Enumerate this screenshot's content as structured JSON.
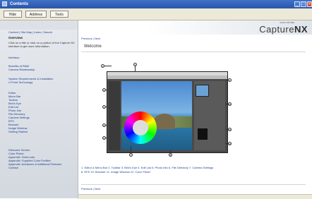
{
  "window": {
    "title": "Contents"
  },
  "tabs": [
    "Hide",
    "Address",
    "Tools"
  ],
  "sidebar": {
    "top_links": "Content | Site Map | Index | Search",
    "heading": "Overview",
    "intro": "Click on a title or click on a portion of the Capture NX interface to get more information.",
    "items": [
      "Interface",
      "Benefits of RAW",
      "Camera Relationship",
      "System Requirements & Installation",
      "U Point Technology",
      "Editor",
      "Menu Bar",
      "Toolbar",
      "Bird's Eye",
      "Edit List",
      "Photo Info",
      "File Directory",
      "Camera Settings",
      "EFS",
      "Browser",
      "Image Window",
      "Getting Started",
      "Welcome Screen",
      "Color Picker",
      "Appendix: Short-cuts",
      "Appendix: Supplied Color Profiles",
      "Appendix: Advances & Additional Features",
      "Contact"
    ]
  },
  "banner": {
    "small": "NIKON CAPTURE",
    "brand_main": "Capture",
    "brand_suffix": "NX"
  },
  "nav": {
    "prev": "Previous",
    "sep": " | ",
    "next": "Next"
  },
  "page_title": "Welcome",
  "links_line1": "1. Editor & Menu Bar  2. Toolbar  3. Bird's Eye  4. Edit List  5. Photo Info  6. File Directory  7. Camera Settings",
  "links_line2": "8. EFS  10. Browser  11. Image Window  12. Color Picker",
  "callouts": [
    "1",
    "2",
    "3",
    "4",
    "5",
    "6",
    "7",
    "8",
    "9",
    "10",
    "11",
    "12"
  ],
  "colors": {
    "titlebar": "#2a55a8",
    "link": "#1d3f8a",
    "sidebar": "#dde1e7"
  }
}
